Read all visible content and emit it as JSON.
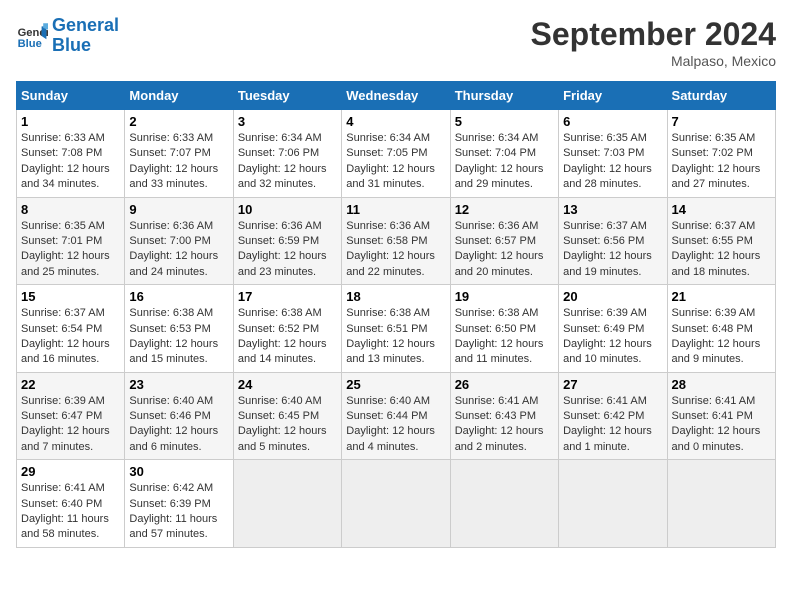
{
  "header": {
    "logo_line1": "General",
    "logo_line2": "Blue",
    "month": "September 2024",
    "location": "Malpaso, Mexico"
  },
  "weekdays": [
    "Sunday",
    "Monday",
    "Tuesday",
    "Wednesday",
    "Thursday",
    "Friday",
    "Saturday"
  ],
  "weeks": [
    [
      {
        "day": "1",
        "info": "Sunrise: 6:33 AM\nSunset: 7:08 PM\nDaylight: 12 hours\nand 34 minutes."
      },
      {
        "day": "2",
        "info": "Sunrise: 6:33 AM\nSunset: 7:07 PM\nDaylight: 12 hours\nand 33 minutes."
      },
      {
        "day": "3",
        "info": "Sunrise: 6:34 AM\nSunset: 7:06 PM\nDaylight: 12 hours\nand 32 minutes."
      },
      {
        "day": "4",
        "info": "Sunrise: 6:34 AM\nSunset: 7:05 PM\nDaylight: 12 hours\nand 31 minutes."
      },
      {
        "day": "5",
        "info": "Sunrise: 6:34 AM\nSunset: 7:04 PM\nDaylight: 12 hours\nand 29 minutes."
      },
      {
        "day": "6",
        "info": "Sunrise: 6:35 AM\nSunset: 7:03 PM\nDaylight: 12 hours\nand 28 minutes."
      },
      {
        "day": "7",
        "info": "Sunrise: 6:35 AM\nSunset: 7:02 PM\nDaylight: 12 hours\nand 27 minutes."
      }
    ],
    [
      {
        "day": "8",
        "info": "Sunrise: 6:35 AM\nSunset: 7:01 PM\nDaylight: 12 hours\nand 25 minutes."
      },
      {
        "day": "9",
        "info": "Sunrise: 6:36 AM\nSunset: 7:00 PM\nDaylight: 12 hours\nand 24 minutes."
      },
      {
        "day": "10",
        "info": "Sunrise: 6:36 AM\nSunset: 6:59 PM\nDaylight: 12 hours\nand 23 minutes."
      },
      {
        "day": "11",
        "info": "Sunrise: 6:36 AM\nSunset: 6:58 PM\nDaylight: 12 hours\nand 22 minutes."
      },
      {
        "day": "12",
        "info": "Sunrise: 6:36 AM\nSunset: 6:57 PM\nDaylight: 12 hours\nand 20 minutes."
      },
      {
        "day": "13",
        "info": "Sunrise: 6:37 AM\nSunset: 6:56 PM\nDaylight: 12 hours\nand 19 minutes."
      },
      {
        "day": "14",
        "info": "Sunrise: 6:37 AM\nSunset: 6:55 PM\nDaylight: 12 hours\nand 18 minutes."
      }
    ],
    [
      {
        "day": "15",
        "info": "Sunrise: 6:37 AM\nSunset: 6:54 PM\nDaylight: 12 hours\nand 16 minutes."
      },
      {
        "day": "16",
        "info": "Sunrise: 6:38 AM\nSunset: 6:53 PM\nDaylight: 12 hours\nand 15 minutes."
      },
      {
        "day": "17",
        "info": "Sunrise: 6:38 AM\nSunset: 6:52 PM\nDaylight: 12 hours\nand 14 minutes."
      },
      {
        "day": "18",
        "info": "Sunrise: 6:38 AM\nSunset: 6:51 PM\nDaylight: 12 hours\nand 13 minutes."
      },
      {
        "day": "19",
        "info": "Sunrise: 6:38 AM\nSunset: 6:50 PM\nDaylight: 12 hours\nand 11 minutes."
      },
      {
        "day": "20",
        "info": "Sunrise: 6:39 AM\nSunset: 6:49 PM\nDaylight: 12 hours\nand 10 minutes."
      },
      {
        "day": "21",
        "info": "Sunrise: 6:39 AM\nSunset: 6:48 PM\nDaylight: 12 hours\nand 9 minutes."
      }
    ],
    [
      {
        "day": "22",
        "info": "Sunrise: 6:39 AM\nSunset: 6:47 PM\nDaylight: 12 hours\nand 7 minutes."
      },
      {
        "day": "23",
        "info": "Sunrise: 6:40 AM\nSunset: 6:46 PM\nDaylight: 12 hours\nand 6 minutes."
      },
      {
        "day": "24",
        "info": "Sunrise: 6:40 AM\nSunset: 6:45 PM\nDaylight: 12 hours\nand 5 minutes."
      },
      {
        "day": "25",
        "info": "Sunrise: 6:40 AM\nSunset: 6:44 PM\nDaylight: 12 hours\nand 4 minutes."
      },
      {
        "day": "26",
        "info": "Sunrise: 6:41 AM\nSunset: 6:43 PM\nDaylight: 12 hours\nand 2 minutes."
      },
      {
        "day": "27",
        "info": "Sunrise: 6:41 AM\nSunset: 6:42 PM\nDaylight: 12 hours\nand 1 minute."
      },
      {
        "day": "28",
        "info": "Sunrise: 6:41 AM\nSunset: 6:41 PM\nDaylight: 12 hours\nand 0 minutes."
      }
    ],
    [
      {
        "day": "29",
        "info": "Sunrise: 6:41 AM\nSunset: 6:40 PM\nDaylight: 11 hours\nand 58 minutes."
      },
      {
        "day": "30",
        "info": "Sunrise: 6:42 AM\nSunset: 6:39 PM\nDaylight: 11 hours\nand 57 minutes."
      },
      {
        "day": "",
        "info": ""
      },
      {
        "day": "",
        "info": ""
      },
      {
        "day": "",
        "info": ""
      },
      {
        "day": "",
        "info": ""
      },
      {
        "day": "",
        "info": ""
      }
    ]
  ]
}
